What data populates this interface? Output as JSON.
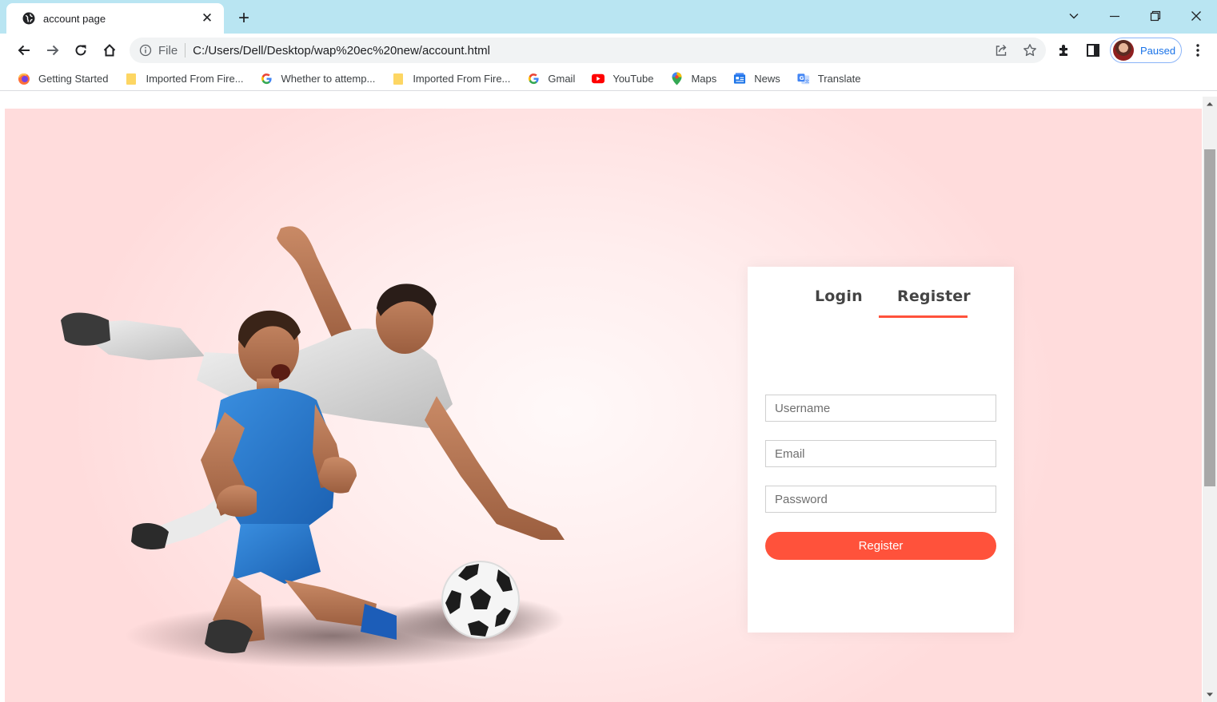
{
  "browser": {
    "tab_title": "account page",
    "new_tab_symbol": "+",
    "url_scheme": "File",
    "url": "C:/Users/Dell/Desktop/wap%20ec%20new/account.html",
    "profile_status": "Paused"
  },
  "bookmarks": [
    {
      "label": "Getting Started",
      "icon": "firefox-icon"
    },
    {
      "label": "Imported From Fire...",
      "icon": "folder-icon"
    },
    {
      "label": "Whether to attemp...",
      "icon": "google-icon"
    },
    {
      "label": "Imported From Fire...",
      "icon": "folder-icon"
    },
    {
      "label": "Gmail",
      "icon": "google-icon"
    },
    {
      "label": "YouTube",
      "icon": "youtube-icon"
    },
    {
      "label": "Maps",
      "icon": "maps-icon"
    },
    {
      "label": "News",
      "icon": "news-icon"
    },
    {
      "label": "Translate",
      "icon": "translate-icon"
    }
  ],
  "form": {
    "tabs": {
      "login": "Login",
      "register": "Register"
    },
    "active_tab": "register",
    "username_placeholder": "Username",
    "email_placeholder": "Email",
    "password_placeholder": "Password",
    "submit_label": "Register"
  },
  "colors": {
    "accent": "#ff523b",
    "tab_strip": "#b9e5f2",
    "page_background": "#ffdcdc"
  }
}
